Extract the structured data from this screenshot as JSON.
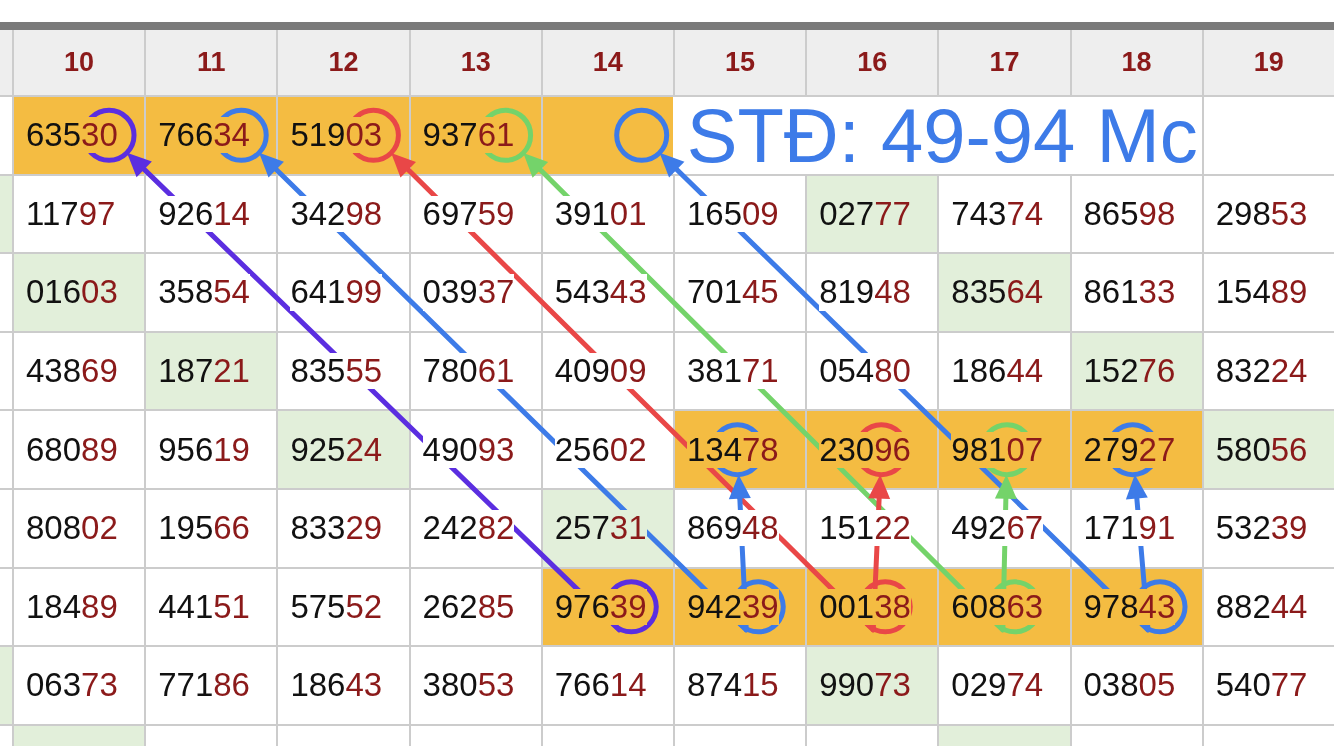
{
  "columns": [
    {
      "label": "10"
    },
    {
      "label": "11"
    },
    {
      "label": "12"
    },
    {
      "label": "13"
    },
    {
      "label": "14"
    },
    {
      "label": "15"
    },
    {
      "label": "16"
    },
    {
      "label": "17"
    },
    {
      "label": "18"
    },
    {
      "label": "19"
    }
  ],
  "rows": [
    {
      "cells": [
        {
          "value": "63530",
          "color": "#f4bc42"
        },
        {
          "value": "76634",
          "color": "#f4bc42"
        },
        {
          "value": "51903",
          "color": "#f4bc42"
        },
        {
          "value": "93761",
          "color": "#f4bc42"
        },
        {
          "kind": "merged",
          "color": "#f4bc42",
          "text": "STĐ: 49-94 Mc"
        },
        {}
      ]
    },
    {
      "edge": {
        "color": "#e2efda"
      },
      "cells": [
        {
          "value": "11797"
        },
        {
          "value": "92614"
        },
        {
          "value": "34298"
        },
        {
          "value": "69759"
        },
        {
          "value": "39101"
        },
        {
          "value": "16509"
        },
        {
          "value": "02777",
          "color": "#e2efda"
        },
        {
          "value": "74374"
        },
        {
          "value": "86598"
        },
        {
          "value": "29853"
        }
      ]
    },
    {
      "cells": [
        {
          "value": "01603",
          "color": "#e2efda"
        },
        {
          "value": "35854"
        },
        {
          "value": "64199"
        },
        {
          "value": "03937"
        },
        {
          "value": "54343"
        },
        {
          "value": "70145"
        },
        {
          "value": "81948"
        },
        {
          "value": "83564",
          "color": "#e2efda"
        },
        {
          "value": "86133"
        },
        {
          "value": "15489"
        }
      ]
    },
    {
      "cells": [
        {
          "value": "43869"
        },
        {
          "value": "18721",
          "color": "#e2efda"
        },
        {
          "value": "83555"
        },
        {
          "value": "78061"
        },
        {
          "value": "40909"
        },
        {
          "value": "38171"
        },
        {
          "value": "05480"
        },
        {
          "value": "18644"
        },
        {
          "value": "15276",
          "color": "#e2efda"
        },
        {
          "value": "83224"
        }
      ]
    },
    {
      "cells": [
        {
          "value": "68089"
        },
        {
          "value": "95619"
        },
        {
          "value": "92524",
          "color": "#e2efda"
        },
        {
          "value": "49093"
        },
        {
          "value": "25602"
        },
        {
          "value": "13478",
          "color": "#f4bc42"
        },
        {
          "value": "23096",
          "color": "#f4bc42"
        },
        {
          "value": "98107",
          "color": "#f4bc42"
        },
        {
          "value": "27927",
          "color": "#f4bc42"
        },
        {
          "value": "58056",
          "color": "#e2efda"
        }
      ]
    },
    {
      "cells": [
        {
          "value": "80802"
        },
        {
          "value": "19566"
        },
        {
          "value": "83329"
        },
        {
          "value": "24282"
        },
        {
          "value": "25731",
          "color": "#e2efda"
        },
        {
          "value": "86948"
        },
        {
          "value": "15122"
        },
        {
          "value": "49267"
        },
        {
          "value": "17191"
        },
        {
          "value": "53239"
        }
      ]
    },
    {
      "cells": [
        {
          "value": "18489"
        },
        {
          "value": "44151"
        },
        {
          "value": "57552"
        },
        {
          "value": "26285"
        },
        {
          "value": "97639",
          "color": "#f4bc42"
        },
        {
          "value": "94239",
          "color": "#f4bc42"
        },
        {
          "value": "00138",
          "color": "#f4bc42"
        },
        {
          "value": "60863",
          "color": "#f4bc42"
        },
        {
          "value": "97843",
          "color": "#f4bc42"
        },
        {
          "value": "88244"
        }
      ]
    },
    {
      "edge": {
        "color": "#e2efda"
      },
      "cells": [
        {
          "value": "06373"
        },
        {
          "value": "77186"
        },
        {
          "value": "18643"
        },
        {
          "value": "38053"
        },
        {
          "value": "76614"
        },
        {
          "value": "87415"
        },
        {
          "value": "99073",
          "color": "#e2efda"
        },
        {
          "value": "02974"
        },
        {
          "value": "03805"
        },
        {
          "value": "54077"
        }
      ]
    },
    {
      "cells": [
        {
          "color": "#e2efda"
        },
        {},
        {},
        {},
        {},
        {},
        {},
        {
          "color": "#e2efda"
        },
        {},
        {}
      ]
    }
  ],
  "annotations": [
    {
      "kind": "circle",
      "color": "#5b2ee0"
    },
    {
      "kind": "circle",
      "color": "#3d7be8"
    },
    {
      "kind": "circle",
      "color": "#e94747"
    },
    {
      "kind": "circle",
      "color": "#74d36a"
    },
    {
      "kind": "circle",
      "color": "#3d7be8"
    },
    {
      "kind": "circle",
      "color": "#3d7be8"
    },
    {
      "kind": "circle",
      "color": "#e94747"
    },
    {
      "kind": "circle",
      "color": "#74d36a"
    },
    {
      "kind": "circle",
      "color": "#3d7be8"
    },
    {
      "kind": "circle",
      "color": "#5b2ee0"
    },
    {
      "kind": "circle",
      "color": "#3d7be8"
    },
    {
      "kind": "circle",
      "color": "#e94747"
    },
    {
      "kind": "circle",
      "color": "#74d36a"
    },
    {
      "kind": "circle",
      "color": "#3d7be8"
    },
    {
      "kind": "arrow",
      "color": "#5b2ee0"
    },
    {
      "kind": "arrow",
      "color": "#3d7be8"
    },
    {
      "kind": "arrow",
      "color": "#e94747"
    },
    {
      "kind": "arrow",
      "color": "#74d36a"
    },
    {
      "kind": "arrow",
      "color": "#3d7be8"
    },
    {
      "kind": "arrow",
      "color": "#3d7be8"
    },
    {
      "kind": "arrow",
      "color": "#e94747"
    },
    {
      "kind": "arrow",
      "color": "#74d36a"
    },
    {
      "kind": "arrow",
      "color": "#3d7be8"
    }
  ]
}
